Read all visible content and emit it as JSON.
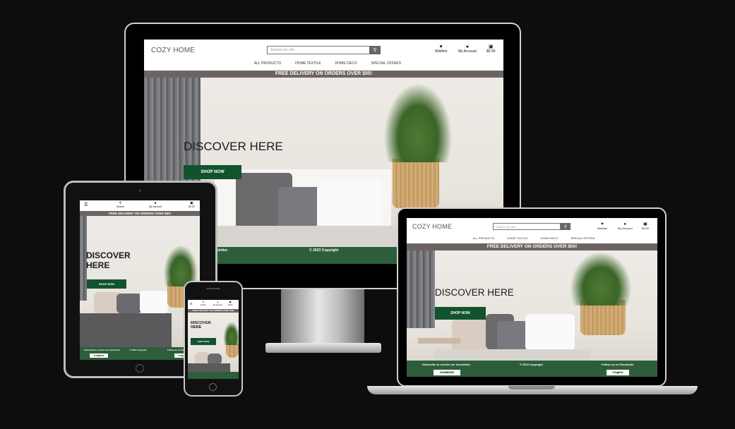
{
  "site": {
    "logo": "COZY HOME",
    "search_placeholder": "Search our site",
    "wishlist": "Wishlist",
    "account": "My Account",
    "cart": "$0.00",
    "search_label": "Search",
    "nav": [
      "ALL PRODUCTS",
      "HOME TEXTILE",
      "HOME DECO",
      "SPECIAL OFFERS"
    ],
    "banner": "FREE DELIVERY ON ORDERS OVER $50!",
    "hero_title": "DISCOVER HERE",
    "hero_title_line1": "DISCOVER",
    "hero_title_line2": "HERE",
    "shop_now": "SHOP NOW",
    "copyright": "© 2023 Copyright",
    "newsletter": "Subscribe to receive our newsletter.",
    "newsletter_short": "nsletter.",
    "subscribe": "SUBSCRIBE",
    "facebook": "Follow us on Facebook!",
    "follow": "FOLLOW"
  },
  "colors": {
    "background": "#0e0d0d",
    "banner": "#6b6462",
    "button": "#11532d",
    "footer": "#2d5e3b"
  },
  "icons": {
    "wishlist": "heart-icon",
    "account": "user-icon",
    "cart": "bag-icon",
    "search": "search-icon",
    "menu": "hamburger-icon",
    "subscribe": "envelope-icon",
    "follow": "facebook-icon"
  }
}
